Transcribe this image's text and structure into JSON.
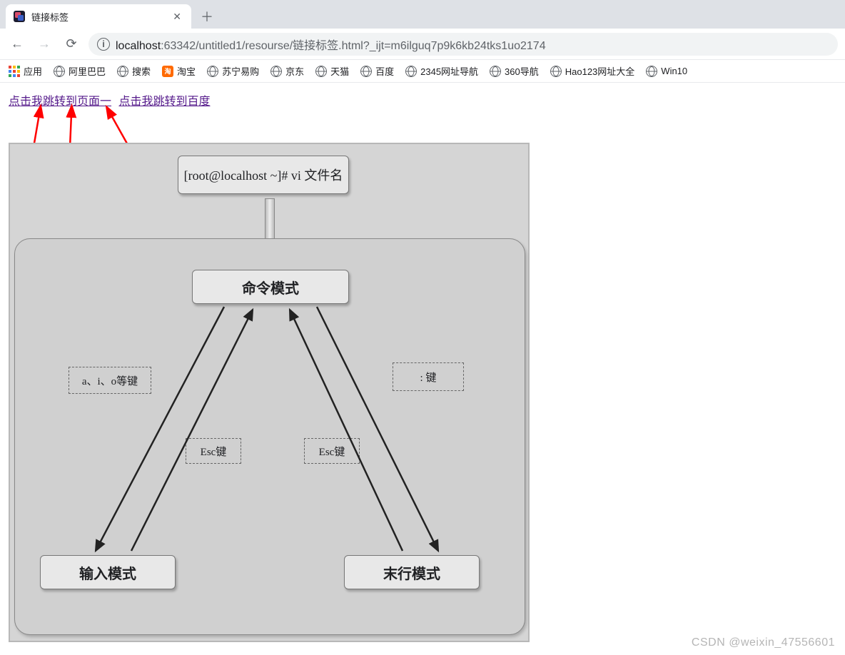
{
  "browser": {
    "tab_title": "链接标签",
    "url_host": "localhost",
    "url_path": ":63342/untitled1/resourse/链接标签.html?_ijt=m6ilguq7p9k6kb24tks1uo2174"
  },
  "bookmarks": {
    "apps": "应用",
    "items": [
      "阿里巴巴",
      "搜索",
      "淘宝",
      "苏宁易购",
      "京东",
      "天猫",
      "百度",
      "2345网址导航",
      "360导航",
      "Hao123网址大全",
      "Win10"
    ]
  },
  "links": {
    "link1": "点击我跳转到页面一",
    "link2": "点击我跳转到百度"
  },
  "diagram": {
    "top": "[root@localhost ~]# vi 文件名",
    "command_mode": "命令模式",
    "input_mode": "输入模式",
    "lastline_mode": "末行模式",
    "keys_aio": "a、i、o等键",
    "key_colon": ": 键",
    "key_esc1": "Esc键",
    "key_esc2": "Esc键"
  },
  "watermark": "CSDN @weixin_47556601"
}
